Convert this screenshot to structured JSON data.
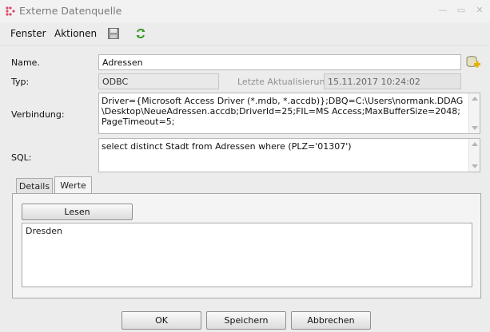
{
  "window": {
    "title": "Externe Datenquelle",
    "controls": {
      "minimize": "—",
      "maximize": "▭",
      "close": "✕"
    }
  },
  "menu": {
    "items": [
      "Fenster",
      "Aktionen"
    ],
    "tools": [
      {
        "name": "save-icon",
        "icon": "floppy-disk"
      },
      {
        "name": "refresh-icon",
        "icon": "green-circular-arrows"
      }
    ]
  },
  "form": {
    "name_label": "Name.",
    "name_value": "Adressen",
    "typ_label": "Typ:",
    "typ_value": "ODBC",
    "last_update_label": "Letzte Aktualisierung:",
    "last_update_value": "15.11.2017 10:24:02",
    "connection_label": "Verbindung:",
    "connection_value": "Driver={Microsoft Access Driver (*.mdb, *.accdb)};DBQ=C:\\Users\\normank.DDAG\\Desktop\\NeueAdressen.accdb;DriverId=25;FIL=MS Access;MaxBufferSize=2048;PageTimeout=5;",
    "sql_label": "SQL:",
    "sql_value": "select distinct Stadt from Adressen where (PLZ='01307')"
  },
  "tabs": [
    {
      "label": "Details",
      "active": false
    },
    {
      "label": "Werte",
      "active": true
    }
  ],
  "werte": {
    "read_button": "Lesen",
    "results": [
      "Dresden"
    ]
  },
  "footer": {
    "ok": "OK",
    "save": "Speichern",
    "cancel": "Abbrechen"
  },
  "colors": {
    "accent_icon_add": "#e8b100",
    "refresh_green": "#3a9b2a"
  }
}
